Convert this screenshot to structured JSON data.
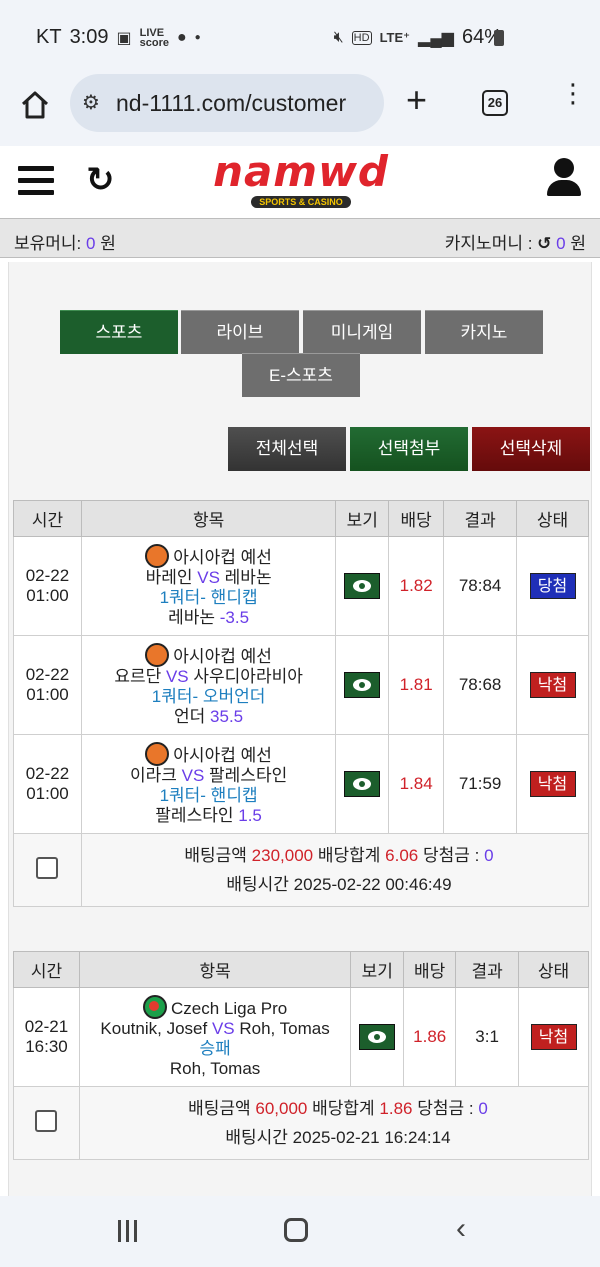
{
  "status": {
    "carrier": "KT",
    "time": "3:09",
    "icons": [
      "image-icon",
      "livescore-icon",
      "basketball-icon",
      "dot-icon"
    ],
    "right_icons": [
      "mute-icon",
      "hd-icon",
      "lte-icon",
      "signal-icon"
    ],
    "lte_label": "LTE⁺",
    "battery": "64%"
  },
  "browser": {
    "url": "nd-1111.com/customer",
    "tab_count": "26"
  },
  "site": {
    "logo_text": "namwd",
    "logo_sub": "SPORTS & CASINO"
  },
  "money": {
    "hold_label": "보유머니:",
    "hold_value": "0",
    "hold_unit": "원",
    "casino_label": "카지노머니 :",
    "casino_value": "0",
    "casino_unit": "원"
  },
  "tabs": [
    {
      "label": "스포츠",
      "active": true
    },
    {
      "label": "라이브",
      "active": false
    },
    {
      "label": "미니게임",
      "active": false
    },
    {
      "label": "카지노",
      "active": false
    },
    {
      "label": "E-스포츠",
      "active": false
    }
  ],
  "actions": {
    "select_all": "전체선택",
    "attach": "선택첨부",
    "delete": "선택삭제"
  },
  "headers": [
    "시간",
    "항목",
    "보기",
    "배당",
    "결과",
    "상태"
  ],
  "slips": [
    {
      "rows": [
        {
          "date": "02-22",
          "time": "01:00",
          "league": "아시아컵 예선",
          "home": "바레인",
          "vs": "VS",
          "away": "레바논",
          "market": "1쿼터- 핸디캡",
          "pick": "레바논",
          "pick_value": "-3.5",
          "odds": "1.82",
          "result": "78:84",
          "status": "당첨",
          "status_type": "win",
          "sport": "basketball"
        },
        {
          "date": "02-22",
          "time": "01:00",
          "league": "아시아컵 예선",
          "home": "요르단",
          "vs": "VS",
          "away": "사우디아라비아",
          "market": "1쿼터- 오버언더",
          "pick": "언더",
          "pick_value": "35.5",
          "odds": "1.81",
          "result": "78:68",
          "status": "낙첨",
          "status_type": "lose",
          "sport": "basketball"
        },
        {
          "date": "02-22",
          "time": "01:00",
          "league": "아시아컵 예선",
          "home": "이라크",
          "vs": "VS",
          "away": "팔레스타인",
          "market": "1쿼터- 핸디캡",
          "pick": "팔레스타인",
          "pick_value": "1.5",
          "odds": "1.84",
          "result": "71:59",
          "status": "낙첨",
          "status_type": "lose",
          "sport": "basketball"
        }
      ],
      "summary": {
        "amount_label": "배팅금액",
        "amount": "230,000",
        "total_label": "배당합계",
        "total": "6.06",
        "win_label": "당첨금 :",
        "win": "0",
        "time_label": "배팅시간",
        "time": "2025-02-22 00:46:49"
      }
    },
    {
      "rows": [
        {
          "date": "02-21",
          "time": "16:30",
          "league": "Czech Liga Pro",
          "home": "Koutnik, Josef",
          "vs": "VS",
          "away": "Roh, Tomas",
          "market": "승패",
          "pick": "Roh, Tomas",
          "pick_value": "",
          "odds": "1.86",
          "result": "3:1",
          "status": "낙첨",
          "status_type": "lose",
          "sport": "table-tennis"
        }
      ],
      "summary": {
        "amount_label": "배팅금액",
        "amount": "60,000",
        "total_label": "배당합계",
        "total": "1.86",
        "win_label": "당첨금 :",
        "win": "0",
        "time_label": "배팅시간",
        "time": "2025-02-21 16:24:14"
      }
    }
  ]
}
